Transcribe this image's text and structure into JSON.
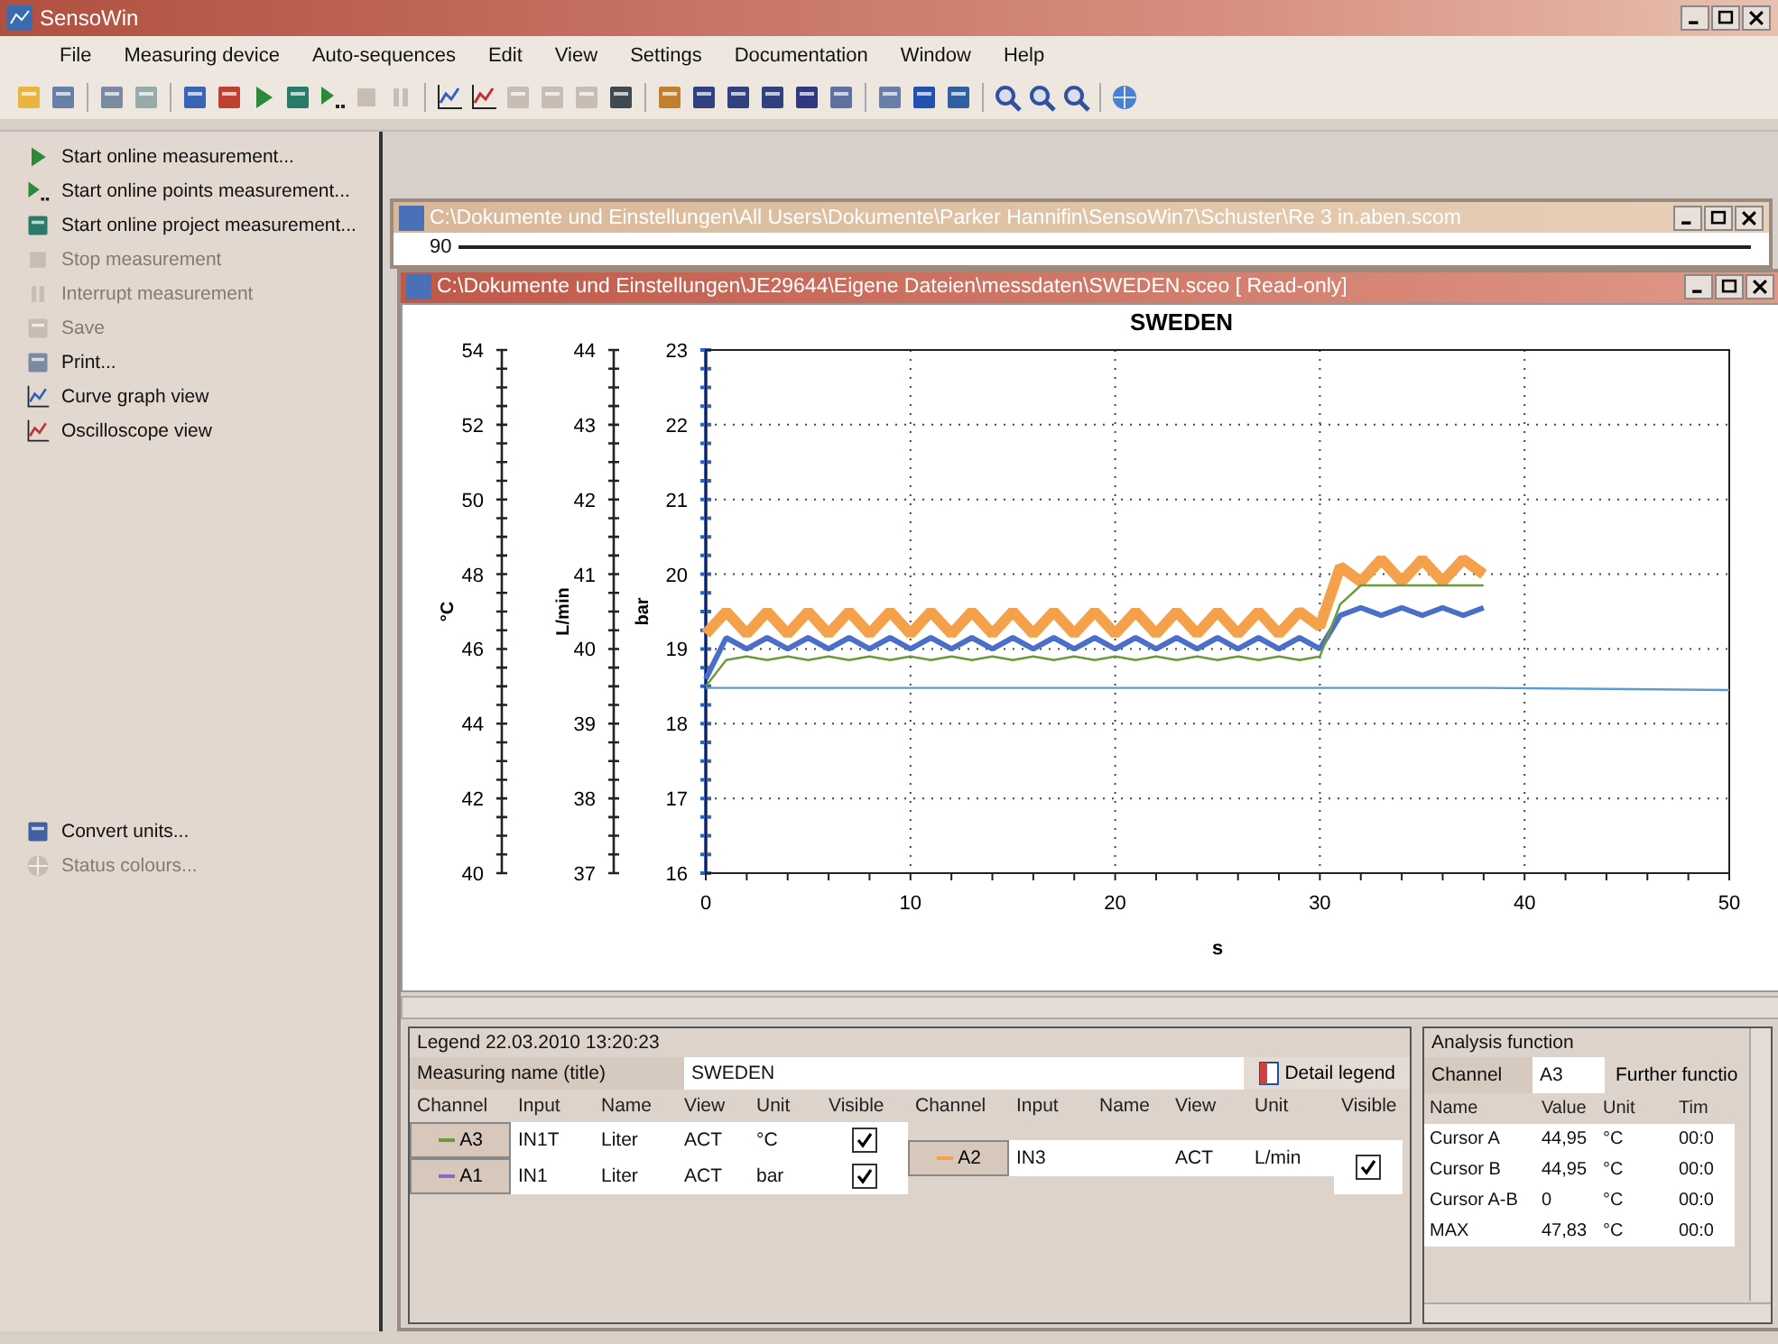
{
  "window": {
    "title": "SensoWin"
  },
  "menu": [
    "File",
    "Measuring device",
    "Auto-sequences",
    "Edit",
    "View",
    "Settings",
    "Documentation",
    "Window",
    "Help"
  ],
  "sidebar": {
    "items": [
      {
        "label": "Start online measurement...",
        "disabled": false
      },
      {
        "label": "Start online points measurement...",
        "disabled": false
      },
      {
        "label": "Start online project measurement...",
        "disabled": false
      },
      {
        "label": "Stop measurement",
        "disabled": true
      },
      {
        "label": "Interrupt measurement",
        "disabled": true
      },
      {
        "label": "Save",
        "disabled": true
      },
      {
        "label": "Print...",
        "disabled": false
      },
      {
        "label": "Curve graph view",
        "disabled": false
      },
      {
        "label": "Oscilloscope view",
        "disabled": false
      },
      {
        "label": "Convert units...",
        "disabled": false
      },
      {
        "label": "Status colours...",
        "disabled": true
      }
    ]
  },
  "back_window": {
    "title": "C:\\Dokumente und Einstellungen\\All Users\\Dokumente\\Parker Hannifin\\SensoWin7\\Schuster\\Re 3 in.aben.scom",
    "axis_label": "90"
  },
  "front_window": {
    "title": "C:\\Dokumente und Einstellungen\\JE29644\\Eigene Dateien\\messdaten\\SWEDEN.sceo [ Read-only]",
    "extra_axes": [
      {
        "unit": "°C",
        "ticks": [
          "54",
          "52",
          "50",
          "48",
          "46",
          "44",
          "42",
          "40"
        ]
      },
      {
        "unit": "L/min",
        "ticks": [
          "44",
          "43",
          "42",
          "41",
          "40",
          "39",
          "38",
          "37"
        ]
      }
    ],
    "chart_data": {
      "type": "line",
      "title": "SWEDEN",
      "xlabel": "s",
      "ylabel": "bar",
      "xlim": [
        0,
        50
      ],
      "ylim": [
        16,
        23
      ],
      "xticks": [
        0,
        10,
        20,
        30,
        40,
        50
      ],
      "yticks": [
        16,
        17,
        18,
        19,
        20,
        21,
        22,
        23
      ],
      "grid": true,
      "x": [
        0,
        1,
        2,
        3,
        4,
        5,
        6,
        7,
        8,
        9,
        10,
        11,
        12,
        13,
        14,
        15,
        16,
        17,
        18,
        19,
        20,
        21,
        22,
        23,
        24,
        25,
        26,
        27,
        28,
        29,
        30,
        31,
        32,
        33,
        34,
        35,
        36,
        37,
        38,
        50
      ],
      "series": [
        {
          "color": "#f5a04a",
          "values": [
            19.2,
            19.5,
            19.2,
            19.5,
            19.2,
            19.5,
            19.2,
            19.5,
            19.2,
            19.5,
            19.2,
            19.5,
            19.2,
            19.5,
            19.2,
            19.5,
            19.2,
            19.5,
            19.2,
            19.5,
            19.2,
            19.5,
            19.2,
            19.5,
            19.2,
            19.5,
            19.2,
            19.5,
            19.2,
            19.5,
            19.3,
            20.1,
            19.9,
            20.2,
            19.9,
            20.2,
            19.9,
            20.2,
            20.0,
            null
          ]
        },
        {
          "color": "#4a6fc8",
          "values": [
            18.6,
            19.15,
            19.0,
            19.15,
            19.0,
            19.15,
            19.0,
            19.15,
            19.0,
            19.15,
            19.0,
            19.15,
            19.0,
            19.15,
            19.0,
            19.15,
            19.0,
            19.15,
            19.0,
            19.15,
            19.0,
            19.15,
            19.0,
            19.15,
            19.0,
            19.15,
            19.0,
            19.15,
            19.0,
            19.15,
            19.0,
            19.45,
            19.55,
            19.45,
            19.55,
            19.45,
            19.55,
            19.45,
            19.55,
            null
          ]
        },
        {
          "color": "#6a9a3a",
          "values": [
            18.5,
            18.85,
            18.9,
            18.85,
            18.9,
            18.85,
            18.9,
            18.85,
            18.9,
            18.85,
            18.9,
            18.85,
            18.9,
            18.85,
            18.9,
            18.85,
            18.9,
            18.85,
            18.9,
            18.85,
            18.9,
            18.85,
            18.9,
            18.85,
            18.9,
            18.85,
            18.9,
            18.85,
            18.9,
            18.85,
            18.9,
            19.6,
            19.85,
            19.85,
            19.85,
            19.85,
            19.85,
            19.85,
            19.85,
            null
          ]
        },
        {
          "color": "#5b9bd5",
          "values": [
            18.48,
            18.48,
            18.48,
            18.48,
            18.48,
            18.48,
            18.48,
            18.48,
            18.48,
            18.48,
            18.48,
            18.48,
            18.48,
            18.48,
            18.48,
            18.48,
            18.48,
            18.48,
            18.48,
            18.48,
            18.48,
            18.48,
            18.48,
            18.48,
            18.48,
            18.48,
            18.48,
            18.48,
            18.48,
            18.48,
            18.48,
            18.48,
            18.48,
            18.48,
            18.48,
            18.48,
            18.48,
            18.48,
            18.48,
            18.45
          ]
        }
      ]
    }
  },
  "legend": {
    "title": "Legend 22.03.2010 13:20:23",
    "name_label": "Measuring name (title)",
    "name_value": "SWEDEN",
    "detail_button": "Detail legend",
    "groups": [
      {
        "columns": [
          "Channel",
          "Input",
          "Name",
          "View",
          "Unit",
          "Visible"
        ],
        "rows": [
          {
            "channel": "A3",
            "color": "#6a9a3a",
            "input": "IN1T",
            "name": "Liter",
            "view": "ACT",
            "unit": "°C",
            "visible": true
          },
          {
            "channel": "A1",
            "color": "#8a6ac8",
            "input": "IN1",
            "name": "Liter",
            "view": "ACT",
            "unit": "bar",
            "visible": true
          }
        ]
      },
      {
        "columns": [
          "Channel",
          "Input",
          "Name",
          "View",
          "Unit",
          "Visible"
        ],
        "rows": [
          {
            "channel": "A2",
            "color": "#f5a04a",
            "input": "IN3",
            "view": "ACT",
            "unit": "L/min",
            "visible": true
          }
        ]
      }
    ]
  },
  "analysis": {
    "title": "Analysis function",
    "channel_label": "Channel",
    "channel_value": "A3",
    "further_button": "Further functio",
    "columns": [
      "Name",
      "Value",
      "Unit",
      "Tim"
    ],
    "rows": [
      [
        "Cursor A",
        "44,95",
        "°C",
        "00:0"
      ],
      [
        "Cursor B",
        "44,95",
        "°C",
        "00:0"
      ],
      [
        "Cursor A-B",
        "0",
        "°C",
        "00:0"
      ],
      [
        "MAX",
        "47,83",
        "°C",
        "00:0"
      ]
    ]
  }
}
